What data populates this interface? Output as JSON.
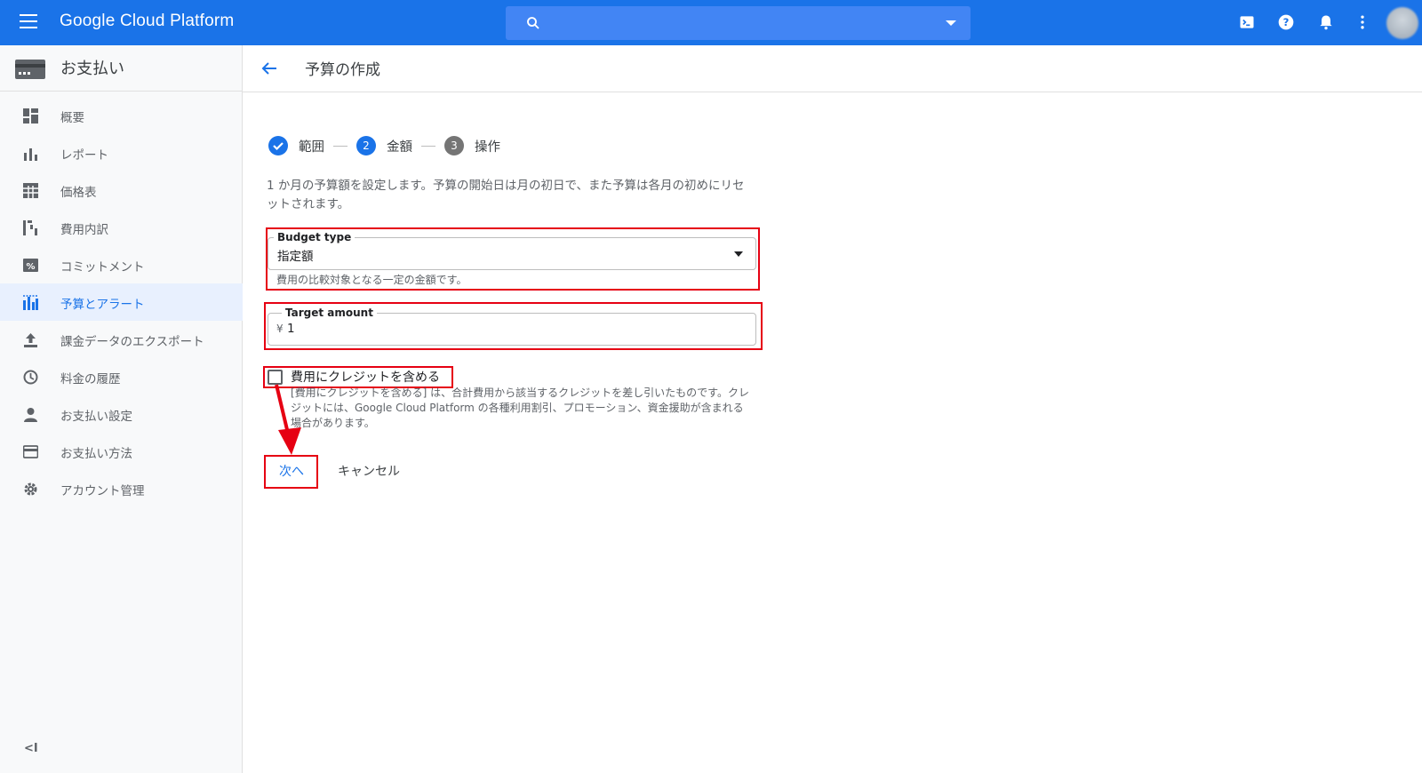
{
  "topbar": {
    "brand": "Google Cloud Platform",
    "search_placeholder": "",
    "icons": [
      "cloud-shell-icon",
      "help-icon",
      "notifications-icon",
      "more-vert-icon"
    ]
  },
  "sidebar": {
    "title": "お支払い",
    "items": [
      {
        "label": "概要",
        "icon": "dashboard-icon"
      },
      {
        "label": "レポート",
        "icon": "bar-chart-icon"
      },
      {
        "label": "価格表",
        "icon": "table-icon"
      },
      {
        "label": "費用内訳",
        "icon": "cost-breakdown-icon"
      },
      {
        "label": "コミットメント",
        "icon": "percent-icon"
      },
      {
        "label": "予算とアラート",
        "icon": "budget-icon",
        "active": true
      },
      {
        "label": "課金データのエクスポート",
        "icon": "upload-icon"
      },
      {
        "label": "料金の履歴",
        "icon": "clock-icon"
      },
      {
        "label": "お支払い設定",
        "icon": "person-icon"
      },
      {
        "label": "お支払い方法",
        "icon": "credit-card-icon"
      },
      {
        "label": "アカウント管理",
        "icon": "gear-icon"
      }
    ],
    "collapse_label": "<I"
  },
  "header": {
    "title": "予算の作成"
  },
  "stepper": {
    "steps": [
      {
        "number": "1",
        "label": "範囲",
        "state": "done"
      },
      {
        "number": "2",
        "label": "金額",
        "state": "current"
      },
      {
        "number": "3",
        "label": "操作",
        "state": "todo"
      }
    ]
  },
  "form": {
    "description": "1 か月の予算額を設定します。予算の開始日は月の初日で、また予算は各月の初めにリセットされます。",
    "budget_type": {
      "label": "Budget type",
      "value": "指定額",
      "helper": "費用の比較対象となる一定の金額です。"
    },
    "target_amount": {
      "label": "Target amount",
      "currency": "¥",
      "value": "1"
    },
    "include_credits": {
      "label": "費用にクレジットを含める",
      "checked": false,
      "help": "[費用にクレジットを含める] は、合計費用から該当するクレジットを差し引いたものです。クレジットには、Google Cloud Platform の各種利用割引、プロモーション、資金援助が含まれる場合があります。"
    },
    "next_label": "次へ",
    "cancel_label": "キャンセル"
  },
  "colors": {
    "primary": "#1a73e8",
    "annotation_red": "#e60012",
    "sidebar_bg": "#f8f9fa",
    "active_bg": "#e8f0fe"
  }
}
